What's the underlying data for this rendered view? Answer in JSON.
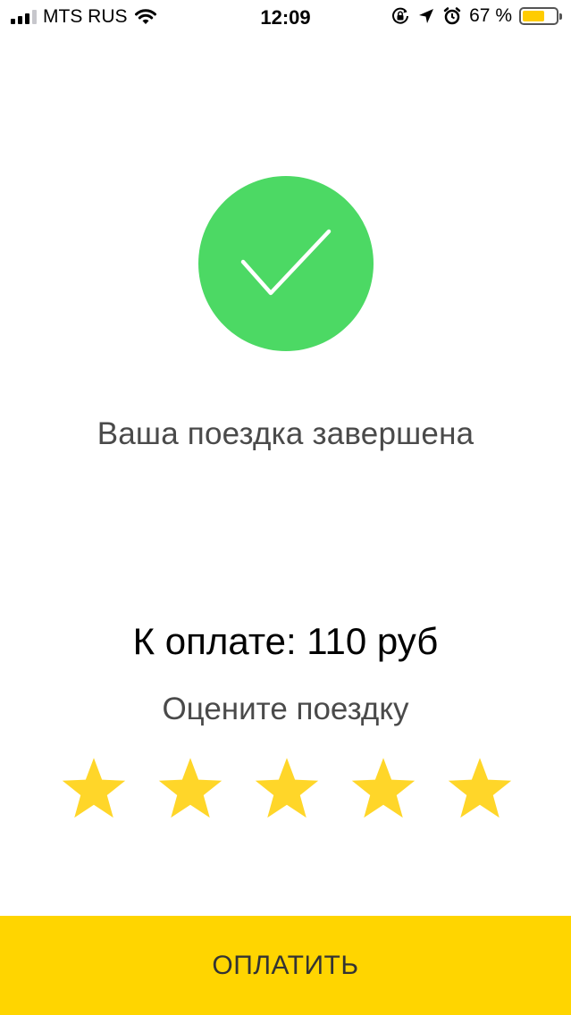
{
  "status_bar": {
    "carrier": "MTS RUS",
    "time": "12:09",
    "battery_percent": "67 %",
    "battery_level": 0.67
  },
  "success": {
    "title": "Ваша поездка завершена"
  },
  "payment": {
    "amount_label": "К оплате: 110 руб"
  },
  "rating": {
    "title": "Оцените поездку",
    "stars_total": 5,
    "star_color": "#ffd629"
  },
  "pay_button": {
    "label": "ОПЛАТИТЬ"
  },
  "colors": {
    "success_green": "#4cd964",
    "accent_yellow": "#ffd500"
  },
  "icons": [
    "signal-icon",
    "wifi-icon",
    "orientation-lock-icon",
    "location-arrow-icon",
    "alarm-icon",
    "battery-icon",
    "checkmark-icon",
    "star-icon"
  ]
}
